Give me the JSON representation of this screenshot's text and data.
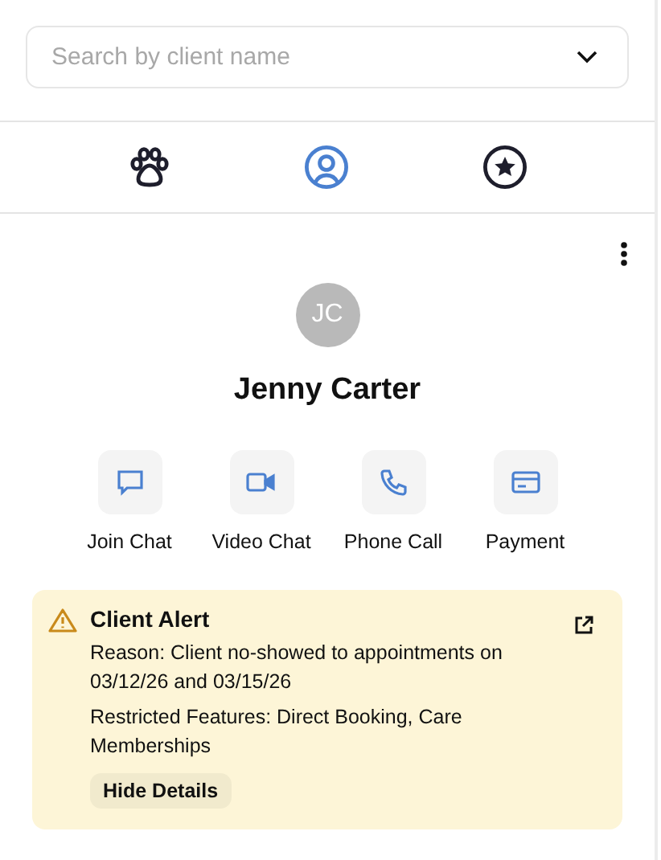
{
  "search": {
    "placeholder": "Search by client name"
  },
  "tabs": [
    {
      "kind": "paw",
      "selected": false
    },
    {
      "kind": "person",
      "selected": true
    },
    {
      "kind": "star",
      "selected": false
    }
  ],
  "client": {
    "initials": "JC",
    "name": "Jenny Carter"
  },
  "actions": [
    {
      "kind": "chat",
      "label": "Join Chat"
    },
    {
      "kind": "video",
      "label": "Video Chat"
    },
    {
      "kind": "phone",
      "label": "Phone Call"
    },
    {
      "kind": "card",
      "label": "Payment"
    }
  ],
  "alert": {
    "title": "Client Alert",
    "reason": "Reason: Client no-showed to appointments on 03/12/26 and 03/15/26",
    "restricted": "Restricted Features: Direct Booking, Care Memberships",
    "button": "Hide Details"
  }
}
